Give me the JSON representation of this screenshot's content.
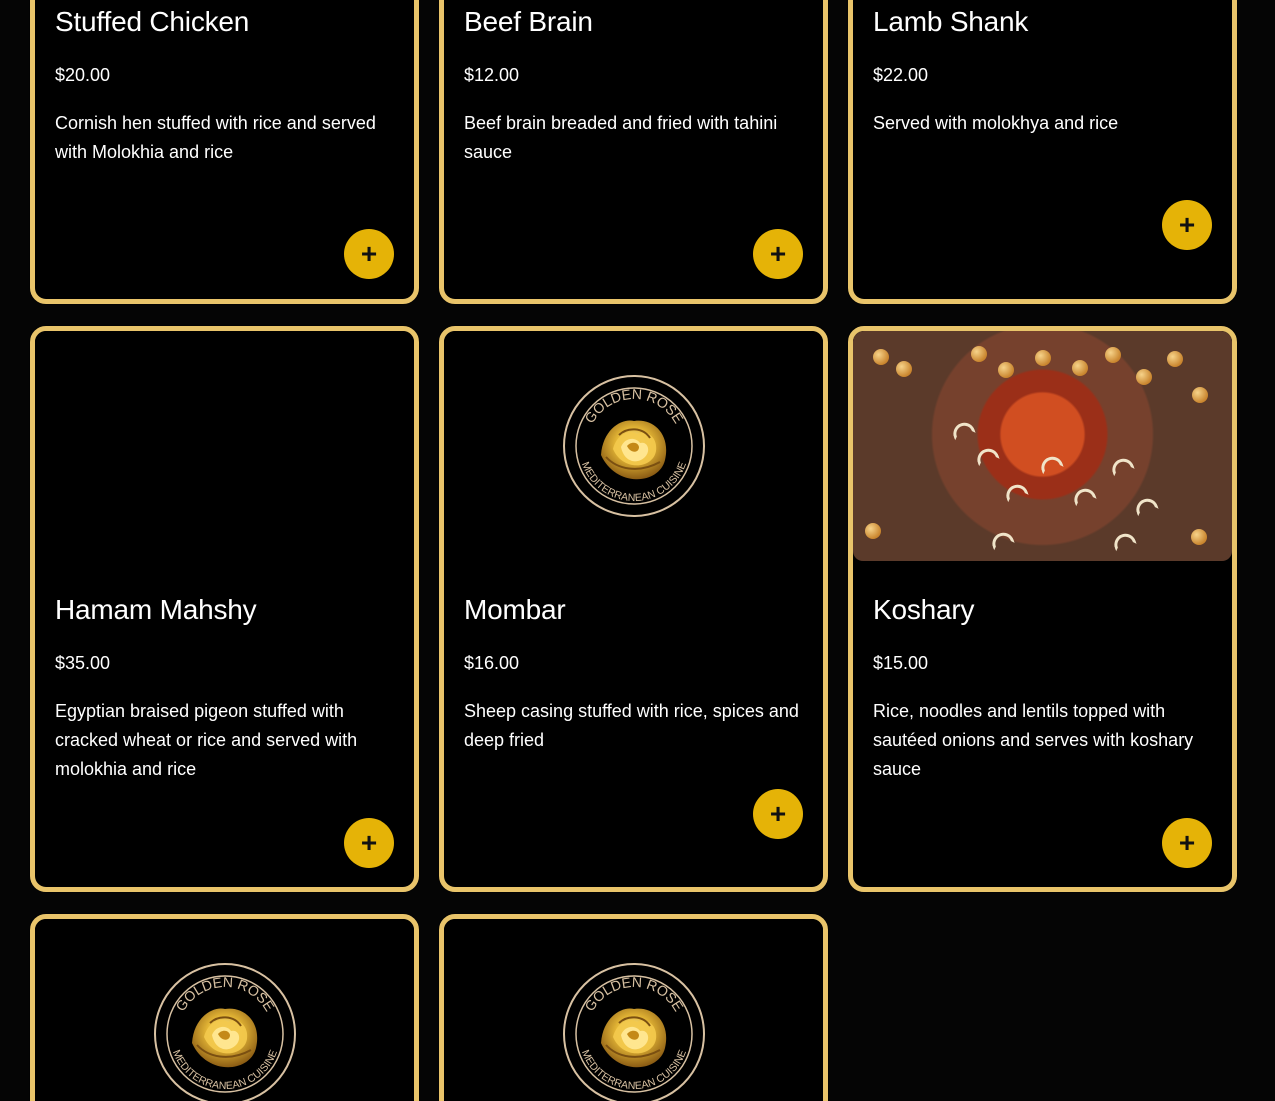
{
  "menu": {
    "items": [
      {
        "title": "Stuffed Chicken",
        "price": "$20.00",
        "description": "Cornish hen stuffed with rice and served with Molokhia and rice",
        "add_label": "+"
      },
      {
        "title": "Beef Brain",
        "price": "$12.00",
        "description": "Beef brain breaded and fried with tahini sauce",
        "add_label": "+"
      },
      {
        "title": "Lamb Shank",
        "price": "$22.00",
        "description": "Served with molokhya and rice",
        "add_label": "+"
      },
      {
        "title": "Hamam Mahshy",
        "price": "$35.00",
        "description": "Egyptian braised pigeon stuffed with cracked wheat or rice and served with molokhia and rice",
        "add_label": "+"
      },
      {
        "title": "Mombar",
        "price": "$16.00",
        "description": "Sheep casing stuffed with rice, spices and deep fried",
        "add_label": "+"
      },
      {
        "title": "Koshary",
        "price": "$15.00",
        "description": "Rice, noodles and lentils topped with sautéed onions and serves with koshary sauce",
        "add_label": "+"
      }
    ]
  },
  "logo": {
    "top_text": "GOLDEN ROSE",
    "bottom_text": "MEDITERRANEAN CUISINE",
    "icon": "rose-logo-icon"
  },
  "colors": {
    "background": "#050505",
    "card_border": "#e9c46a",
    "add_button": "#e5b307"
  }
}
